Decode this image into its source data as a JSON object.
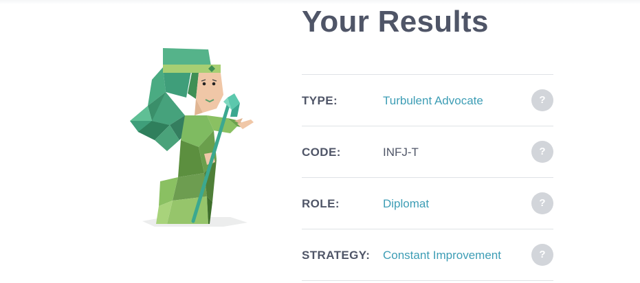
{
  "title": "Your Results",
  "illustration": {
    "name": "advocate-character"
  },
  "results": [
    {
      "label": "TYPE:",
      "value": "Turbulent Advocate",
      "help": "?"
    },
    {
      "label": "CODE:",
      "value": "INFJ-T",
      "help": "?"
    },
    {
      "label": "ROLE:",
      "value": "Diplomat",
      "help": "?"
    },
    {
      "label": "STRATEGY:",
      "value": "Constant Improvement",
      "help": "?"
    }
  ],
  "colors": {
    "heading": "#4f5567",
    "link": "#3d9db5",
    "help_button": "#d2d5da",
    "divider": "#dfe2e6"
  }
}
